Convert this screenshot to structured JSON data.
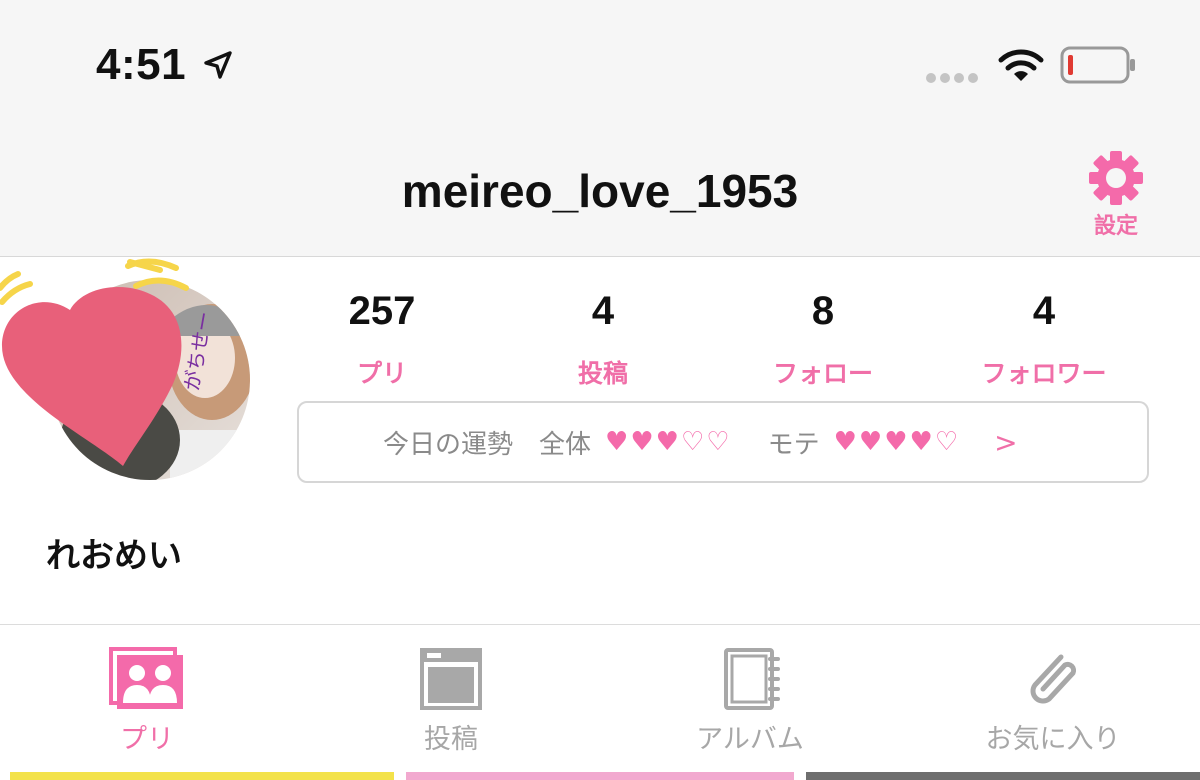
{
  "status_bar": {
    "time": "4:51"
  },
  "header": {
    "username": "meireo_love_1953",
    "settings_label": "設定"
  },
  "profile": {
    "display_name": "れおめい",
    "stats": [
      {
        "value": "257",
        "label": "プリ"
      },
      {
        "value": "4",
        "label": "投稿"
      },
      {
        "value": "8",
        "label": "フォロー"
      },
      {
        "value": "4",
        "label": "フォロワー"
      }
    ],
    "fortune": {
      "title": "今日の運勢",
      "overall_label": "全体",
      "overall_hearts": "♥♥♥♡♡",
      "popularity_label": "モテ",
      "popularity_hearts": "♥♥♥♥♡",
      "arrow": ">"
    }
  },
  "tabs": [
    {
      "label": "プリ",
      "icon": "photos-icon",
      "active": true
    },
    {
      "label": "投稿",
      "icon": "post-icon",
      "active": false
    },
    {
      "label": "アルバム",
      "icon": "album-icon",
      "active": false
    },
    {
      "label": "お気に入り",
      "icon": "paperclip-icon",
      "active": false
    }
  ],
  "colors": {
    "accent": "#f06fa8",
    "heart_sticker": "#e8607a",
    "strip_yellow": "#f3e24a",
    "strip_pink": "#f2a9cf",
    "strip_gray": "#6e6e6e"
  }
}
